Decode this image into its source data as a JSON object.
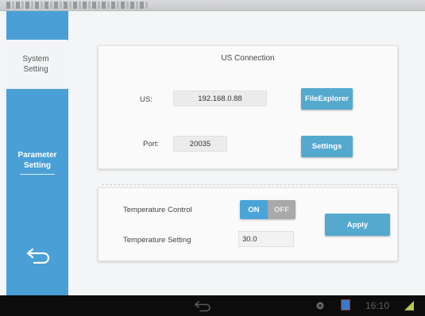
{
  "sidebar": {
    "system_setting_line1": "System",
    "system_setting_line2": "Setting",
    "parameter_setting_line1": "Parameter",
    "parameter_setting_line2": "Setting",
    "back_icon": "back-arrow-icon"
  },
  "us_connection": {
    "title": "US Connection",
    "us_label": "US:",
    "us_value": "192.168.0.88",
    "file_explorer_label": "FileExplorer",
    "port_label": "Port:",
    "port_value": "20035",
    "settings_label": "Settings"
  },
  "temperature": {
    "control_label": "Temperature Control",
    "toggle_on": "ON",
    "toggle_off": "OFF",
    "toggle_state": "on",
    "setting_label": "Temperature Setting",
    "setting_value": "30.0",
    "apply_label": "Apply"
  },
  "status_bar": {
    "time": "16:10"
  },
  "colors": {
    "sidebar": "#4a9fd6",
    "button": "#55a9cf",
    "toggle_on": "#4ba4d8",
    "toggle_off": "#a9a9a9",
    "nav_bar": "#0c0c0c"
  }
}
